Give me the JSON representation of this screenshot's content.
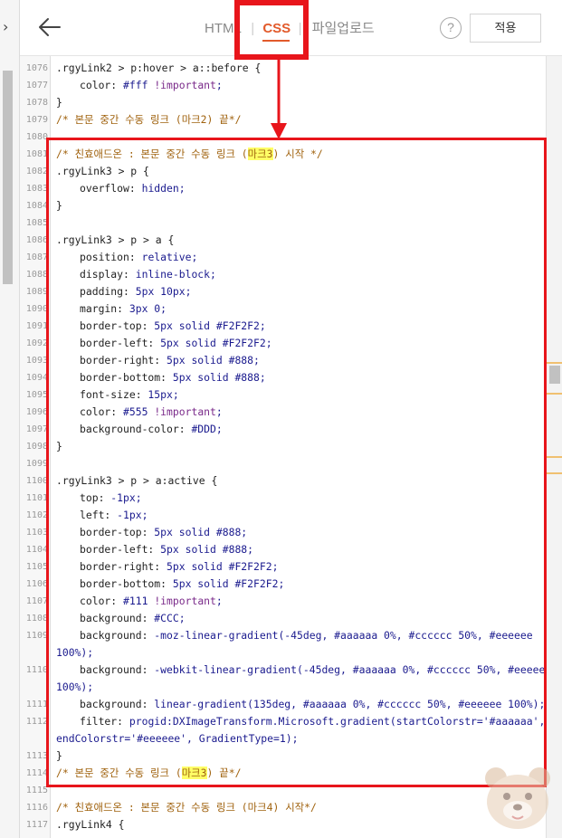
{
  "header": {
    "back_icon": "arrow-left-icon",
    "tabs": [
      {
        "label": "HTML",
        "active": false
      },
      {
        "label": "CSS",
        "active": true
      },
      {
        "label": "파일업로드",
        "active": false
      }
    ],
    "separator": "|",
    "help_label": "?",
    "apply_label": "적용"
  },
  "sidebar": {
    "collapse_icon": "chevron-right-icon",
    "collapse_glyph": "›"
  },
  "colors": {
    "accent": "#e25a2b",
    "annotation": "#e8151b",
    "highlight": "#ffff66"
  },
  "editor": {
    "lines": [
      {
        "n": "1076",
        "text": ".rgyLink2 > p:hover > a::before {"
      },
      {
        "n": "1077",
        "text": "color: #fff !important;"
      },
      {
        "n": "1078",
        "text": "}"
      },
      {
        "n": "1079",
        "text": "/* 본문 중간 수동 링크 (마크2) 끝*/"
      },
      {
        "n": "1080",
        "text": ""
      },
      {
        "n": "1081",
        "text": "/* 친효애드온 : 본문 중간 수동 링크 (마크3) 시작 */"
      },
      {
        "n": "1082",
        "text": ".rgyLink3 > p {"
      },
      {
        "n": "1083",
        "text": "overflow: hidden;"
      },
      {
        "n": "1084",
        "text": "}"
      },
      {
        "n": "1085",
        "text": ""
      },
      {
        "n": "1086",
        "text": ".rgyLink3 > p > a {"
      },
      {
        "n": "1087",
        "text": "position: relative;"
      },
      {
        "n": "1088",
        "text": "display: inline-block;"
      },
      {
        "n": "1089",
        "text": "padding: 5px 10px;"
      },
      {
        "n": "1090",
        "text": "margin: 3px 0;"
      },
      {
        "n": "1091",
        "text": "border-top: 5px solid #F2F2F2;"
      },
      {
        "n": "1092",
        "text": "border-left: 5px solid #F2F2F2;"
      },
      {
        "n": "1093",
        "text": "border-right: 5px solid #888;"
      },
      {
        "n": "1094",
        "text": "border-bottom: 5px solid #888;"
      },
      {
        "n": "1095",
        "text": "font-size: 15px;"
      },
      {
        "n": "1096",
        "text": "color: #555 !important;"
      },
      {
        "n": "1097",
        "text": "background-color: #DDD;"
      },
      {
        "n": "1098",
        "text": "}"
      },
      {
        "n": "1099",
        "text": ""
      },
      {
        "n": "1100",
        "text": ".rgyLink3 > p > a:active {"
      },
      {
        "n": "1101",
        "text": "top: -1px;"
      },
      {
        "n": "1102",
        "text": "left: -1px;"
      },
      {
        "n": "1103",
        "text": "border-top: 5px solid #888;"
      },
      {
        "n": "1104",
        "text": "border-left: 5px solid #888;"
      },
      {
        "n": "1105",
        "text": "border-right: 5px solid #F2F2F2;"
      },
      {
        "n": "1106",
        "text": "border-bottom: 5px solid #F2F2F2;"
      },
      {
        "n": "1107",
        "text": "color: #111 !important;"
      },
      {
        "n": "1108",
        "text": "background: #CCC;"
      },
      {
        "n": "1109",
        "text": "background: -moz-linear-gradient(-45deg, #aaaaaa 0%, #cccccc 50%, #eeeeee"
      },
      {
        "n": "",
        "text": "100%);"
      },
      {
        "n": "1110",
        "text": "background: -webkit-linear-gradient(-45deg, #aaaaaa 0%, #cccccc 50%, #eeeeee"
      },
      {
        "n": "",
        "text": "100%);"
      },
      {
        "n": "1111",
        "text": "background: linear-gradient(135deg, #aaaaaa 0%, #cccccc 50%, #eeeeee 100%);"
      },
      {
        "n": "1112",
        "text": "filter: progid:DXImageTransform.Microsoft.gradient(startColorstr='#aaaaaa',"
      },
      {
        "n": "",
        "text": "endColorstr='#eeeeee', GradientType=1);"
      },
      {
        "n": "1113",
        "text": "}"
      },
      {
        "n": "1114",
        "text": "/* 본문 중간 수동 링크 (마크3) 끝*/"
      },
      {
        "n": "1115",
        "text": ""
      },
      {
        "n": "1116",
        "text": "/* 친효애드온 : 본문 중간 수동 링크 (마크4) 시작*/"
      },
      {
        "n": "1117",
        "text": ".rgyLink4 {"
      }
    ]
  }
}
